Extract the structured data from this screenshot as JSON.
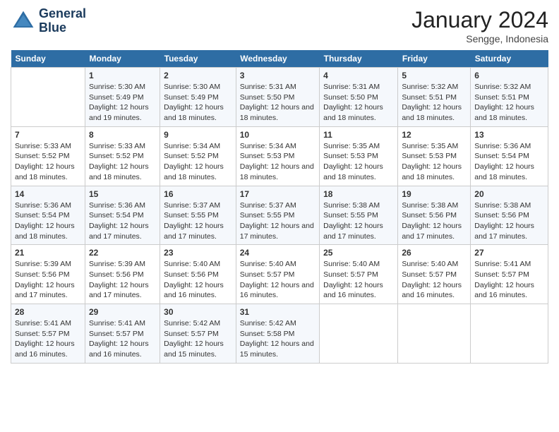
{
  "header": {
    "logo_line1": "General",
    "logo_line2": "Blue",
    "title": "January 2024",
    "subtitle": "Sengge, Indonesia"
  },
  "weekdays": [
    "Sunday",
    "Monday",
    "Tuesday",
    "Wednesday",
    "Thursday",
    "Friday",
    "Saturday"
  ],
  "weeks": [
    [
      {
        "day": "",
        "sunrise": "",
        "sunset": "",
        "daylight": "",
        "empty": true
      },
      {
        "day": "1",
        "sunrise": "Sunrise: 5:30 AM",
        "sunset": "Sunset: 5:49 PM",
        "daylight": "Daylight: 12 hours and 19 minutes."
      },
      {
        "day": "2",
        "sunrise": "Sunrise: 5:30 AM",
        "sunset": "Sunset: 5:49 PM",
        "daylight": "Daylight: 12 hours and 18 minutes."
      },
      {
        "day": "3",
        "sunrise": "Sunrise: 5:31 AM",
        "sunset": "Sunset: 5:50 PM",
        "daylight": "Daylight: 12 hours and 18 minutes."
      },
      {
        "day": "4",
        "sunrise": "Sunrise: 5:31 AM",
        "sunset": "Sunset: 5:50 PM",
        "daylight": "Daylight: 12 hours and 18 minutes."
      },
      {
        "day": "5",
        "sunrise": "Sunrise: 5:32 AM",
        "sunset": "Sunset: 5:51 PM",
        "daylight": "Daylight: 12 hours and 18 minutes."
      },
      {
        "day": "6",
        "sunrise": "Sunrise: 5:32 AM",
        "sunset": "Sunset: 5:51 PM",
        "daylight": "Daylight: 12 hours and 18 minutes."
      }
    ],
    [
      {
        "day": "7",
        "sunrise": "Sunrise: 5:33 AM",
        "sunset": "Sunset: 5:52 PM",
        "daylight": "Daylight: 12 hours and 18 minutes."
      },
      {
        "day": "8",
        "sunrise": "Sunrise: 5:33 AM",
        "sunset": "Sunset: 5:52 PM",
        "daylight": "Daylight: 12 hours and 18 minutes."
      },
      {
        "day": "9",
        "sunrise": "Sunrise: 5:34 AM",
        "sunset": "Sunset: 5:52 PM",
        "daylight": "Daylight: 12 hours and 18 minutes."
      },
      {
        "day": "10",
        "sunrise": "Sunrise: 5:34 AM",
        "sunset": "Sunset: 5:53 PM",
        "daylight": "Daylight: 12 hours and 18 minutes."
      },
      {
        "day": "11",
        "sunrise": "Sunrise: 5:35 AM",
        "sunset": "Sunset: 5:53 PM",
        "daylight": "Daylight: 12 hours and 18 minutes."
      },
      {
        "day": "12",
        "sunrise": "Sunrise: 5:35 AM",
        "sunset": "Sunset: 5:53 PM",
        "daylight": "Daylight: 12 hours and 18 minutes."
      },
      {
        "day": "13",
        "sunrise": "Sunrise: 5:36 AM",
        "sunset": "Sunset: 5:54 PM",
        "daylight": "Daylight: 12 hours and 18 minutes."
      }
    ],
    [
      {
        "day": "14",
        "sunrise": "Sunrise: 5:36 AM",
        "sunset": "Sunset: 5:54 PM",
        "daylight": "Daylight: 12 hours and 18 minutes."
      },
      {
        "day": "15",
        "sunrise": "Sunrise: 5:36 AM",
        "sunset": "Sunset: 5:54 PM",
        "daylight": "Daylight: 12 hours and 17 minutes."
      },
      {
        "day": "16",
        "sunrise": "Sunrise: 5:37 AM",
        "sunset": "Sunset: 5:55 PM",
        "daylight": "Daylight: 12 hours and 17 minutes."
      },
      {
        "day": "17",
        "sunrise": "Sunrise: 5:37 AM",
        "sunset": "Sunset: 5:55 PM",
        "daylight": "Daylight: 12 hours and 17 minutes."
      },
      {
        "day": "18",
        "sunrise": "Sunrise: 5:38 AM",
        "sunset": "Sunset: 5:55 PM",
        "daylight": "Daylight: 12 hours and 17 minutes."
      },
      {
        "day": "19",
        "sunrise": "Sunrise: 5:38 AM",
        "sunset": "Sunset: 5:56 PM",
        "daylight": "Daylight: 12 hours and 17 minutes."
      },
      {
        "day": "20",
        "sunrise": "Sunrise: 5:38 AM",
        "sunset": "Sunset: 5:56 PM",
        "daylight": "Daylight: 12 hours and 17 minutes."
      }
    ],
    [
      {
        "day": "21",
        "sunrise": "Sunrise: 5:39 AM",
        "sunset": "Sunset: 5:56 PM",
        "daylight": "Daylight: 12 hours and 17 minutes."
      },
      {
        "day": "22",
        "sunrise": "Sunrise: 5:39 AM",
        "sunset": "Sunset: 5:56 PM",
        "daylight": "Daylight: 12 hours and 17 minutes."
      },
      {
        "day": "23",
        "sunrise": "Sunrise: 5:40 AM",
        "sunset": "Sunset: 5:56 PM",
        "daylight": "Daylight: 12 hours and 16 minutes."
      },
      {
        "day": "24",
        "sunrise": "Sunrise: 5:40 AM",
        "sunset": "Sunset: 5:57 PM",
        "daylight": "Daylight: 12 hours and 16 minutes."
      },
      {
        "day": "25",
        "sunrise": "Sunrise: 5:40 AM",
        "sunset": "Sunset: 5:57 PM",
        "daylight": "Daylight: 12 hours and 16 minutes."
      },
      {
        "day": "26",
        "sunrise": "Sunrise: 5:40 AM",
        "sunset": "Sunset: 5:57 PM",
        "daylight": "Daylight: 12 hours and 16 minutes."
      },
      {
        "day": "27",
        "sunrise": "Sunrise: 5:41 AM",
        "sunset": "Sunset: 5:57 PM",
        "daylight": "Daylight: 12 hours and 16 minutes."
      }
    ],
    [
      {
        "day": "28",
        "sunrise": "Sunrise: 5:41 AM",
        "sunset": "Sunset: 5:57 PM",
        "daylight": "Daylight: 12 hours and 16 minutes."
      },
      {
        "day": "29",
        "sunrise": "Sunrise: 5:41 AM",
        "sunset": "Sunset: 5:57 PM",
        "daylight": "Daylight: 12 hours and 16 minutes."
      },
      {
        "day": "30",
        "sunrise": "Sunrise: 5:42 AM",
        "sunset": "Sunset: 5:57 PM",
        "daylight": "Daylight: 12 hours and 15 minutes."
      },
      {
        "day": "31",
        "sunrise": "Sunrise: 5:42 AM",
        "sunset": "Sunset: 5:58 PM",
        "daylight": "Daylight: 12 hours and 15 minutes."
      },
      {
        "day": "",
        "sunrise": "",
        "sunset": "",
        "daylight": "",
        "empty": true
      },
      {
        "day": "",
        "sunrise": "",
        "sunset": "",
        "daylight": "",
        "empty": true
      },
      {
        "day": "",
        "sunrise": "",
        "sunset": "",
        "daylight": "",
        "empty": true
      }
    ]
  ]
}
